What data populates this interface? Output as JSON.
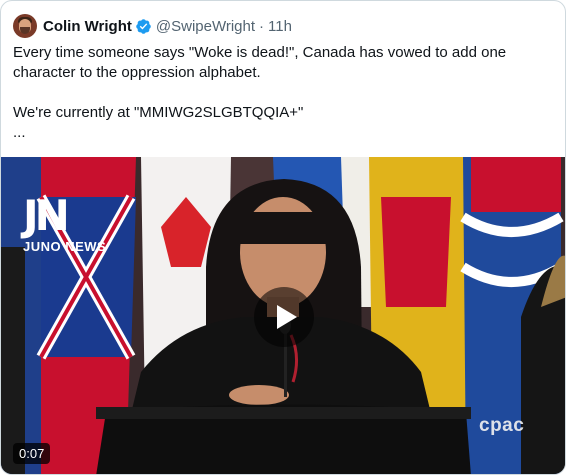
{
  "tweet": {
    "author_name": "Colin Wright",
    "handle": "@SwipeWright",
    "separator": "·",
    "time": "11h",
    "verified_icon": "verified-badge-icon",
    "text": "Every time someone says \"Woke is dead!\", Canada has vowed to add one character to the oppression alphabet.\n\nWe're currently at \"MMIWG2SLGBTQQIA+\"\n..."
  },
  "media": {
    "logo_mark": "JN",
    "logo_word": "JUNO NEWS",
    "watermark": "cpac",
    "duration": "0:07",
    "play_icon": "play-icon"
  },
  "colors": {
    "verified": "#1d9bf0",
    "muted_text": "#536471",
    "border": "#cfd9de"
  }
}
